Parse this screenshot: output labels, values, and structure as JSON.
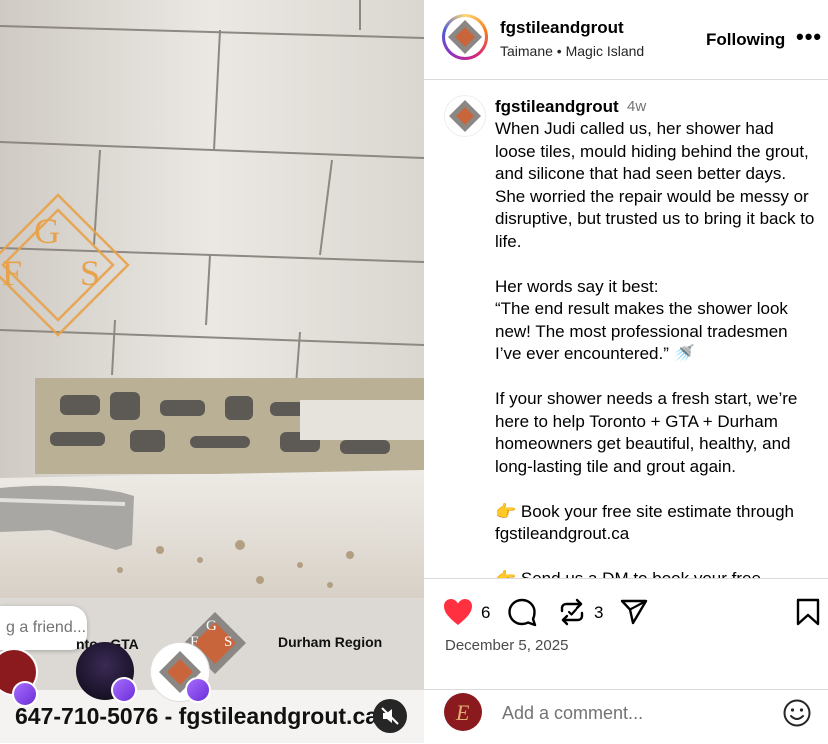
{
  "header": {
    "username": "fgstileandgrout",
    "location": "Taimane • Magic Island",
    "follow_label": "Following",
    "more_label": "•••",
    "logo_letters": [
      "F",
      "G",
      "S"
    ]
  },
  "caption": {
    "username": "fgstileandgrout",
    "time_ago": "4w",
    "text": "When Judi called us, her shower had loose tiles, mould hiding behind the grout, and silicone that had seen better days. She worried the repair would be messy or disruptive, but trusted us to bring it back to life.\n\nHer words say it best:\n“The end result makes the shower look new! The most professional tradesmen I’ve ever encountered.” 🚿\n\nIf your shower needs a fresh start, we’re here to help Toronto + GTA + Durham homeowners get beautiful, healthy, and long-lasting tile and grout again.\n\n👉 Book your free site estimate through fgstileandgrout.ca\n\n👉 Send us a DM to book your free"
  },
  "actions": {
    "likes": "6",
    "reposts": "3",
    "date": "December 5, 2025"
  },
  "comment": {
    "placeholder": "Add a comment...",
    "avatar_letter": "E"
  },
  "media": {
    "watermark_letters": [
      "F",
      "G",
      "S"
    ],
    "friend_prompt": "g a friend...",
    "region_left": "nto - GTA",
    "region_right": "Durham Region",
    "phone_line": "647-710-5076 - fgstileandgrout.ca",
    "badge_letters": [
      "F",
      "G",
      "S"
    ]
  },
  "colors": {
    "like": "#ff3040",
    "repost_badge": "#8b4dff",
    "muted_text": "#737373",
    "brand_orange": "#e8a24a"
  }
}
